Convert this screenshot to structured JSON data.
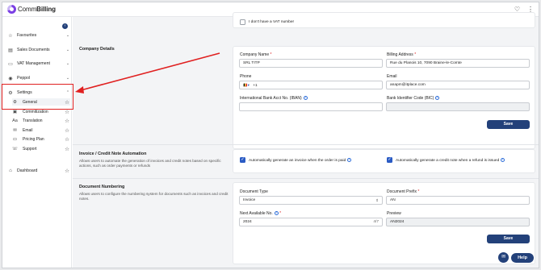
{
  "app": {
    "logo_prefix": "Comm",
    "logo_suffix": "Billing",
    "top_icons": [
      "heart-icon",
      "more-vertical-icon"
    ]
  },
  "sidebar": {
    "collapse_icon": "chevron-left-icon",
    "items": [
      {
        "label": "Favourites",
        "icon": "star-icon",
        "expandable": true
      },
      {
        "label": "Sales Documents",
        "icon": "document-icon",
        "expandable": true
      },
      {
        "label": "VAT Management",
        "icon": "percent-icon",
        "expandable": true
      },
      {
        "label": "Peppol",
        "icon": "globe-icon",
        "expandable": true
      },
      {
        "label": "Settings",
        "icon": "gear-icon",
        "expandable": true,
        "expanded": true
      },
      {
        "label": "Dashboard",
        "icon": "home-icon",
        "expandable": false
      }
    ],
    "settings_children": [
      {
        "label": "General",
        "icon": "gear-icon",
        "active": true
      },
      {
        "label": "Commitization",
        "icon": "file-icon"
      },
      {
        "label": "Translation",
        "icon": "translate-icon"
      },
      {
        "label": "Email",
        "icon": "mail-icon"
      },
      {
        "label": "Pricing Plan",
        "icon": "card-icon"
      },
      {
        "label": "Support",
        "icon": "support-icon"
      }
    ]
  },
  "vat": {
    "no_vat_label": "I don't have a VAT number",
    "no_vat_checked": false
  },
  "company": {
    "title": "Company Details",
    "company_name_label": "Company Name",
    "company_name_value": "SRL TITP",
    "billing_address_label": "Billing Address",
    "billing_address_value": "Rue du Planois 10, 7090 Braine-le-Comte",
    "phone_label": "Phone",
    "phone_country": "BE",
    "phone_value": "+1",
    "email_label": "Email",
    "email_value": "anapm@itplace.com",
    "iban_label": "International Bank Acct No. (IBAN)",
    "iban_value": "",
    "bic_label": "Bank Identifier Code (BIC)",
    "bic_value": "",
    "save_label": "Save"
  },
  "automation": {
    "title": "Invoice / Credit Note Automation",
    "description": "Allows users to automate the generation of invoices and credit notes based on specific actions, such as order payments or refunds",
    "invoice_label": "Automatically generate an invoice when the order is paid",
    "invoice_checked": true,
    "credit_label": "Automatically generate a credit note when a refund is issued",
    "credit_checked": true
  },
  "numbering": {
    "title": "Document Numbering",
    "description": "Allows users to configure the numbering system for documents such as invoices and credit notes.",
    "doc_type_label": "Document Type",
    "doc_type_value": "Invoice",
    "doc_prefix_label": "Document Prefix",
    "doc_prefix_value": "AN",
    "next_no_label": "Next Available No.",
    "next_no_value": "2024",
    "next_no_counter": "4/7",
    "preview_label": "Preview",
    "preview_value": "AN2024",
    "save_label": "Save"
  },
  "help": {
    "label": "Help",
    "chat_icon": "chat-icon"
  },
  "colors": {
    "primary": "#23417a",
    "checkbox": "#2a5bc4",
    "annotation": "#e02020",
    "required": "#dd2222"
  }
}
